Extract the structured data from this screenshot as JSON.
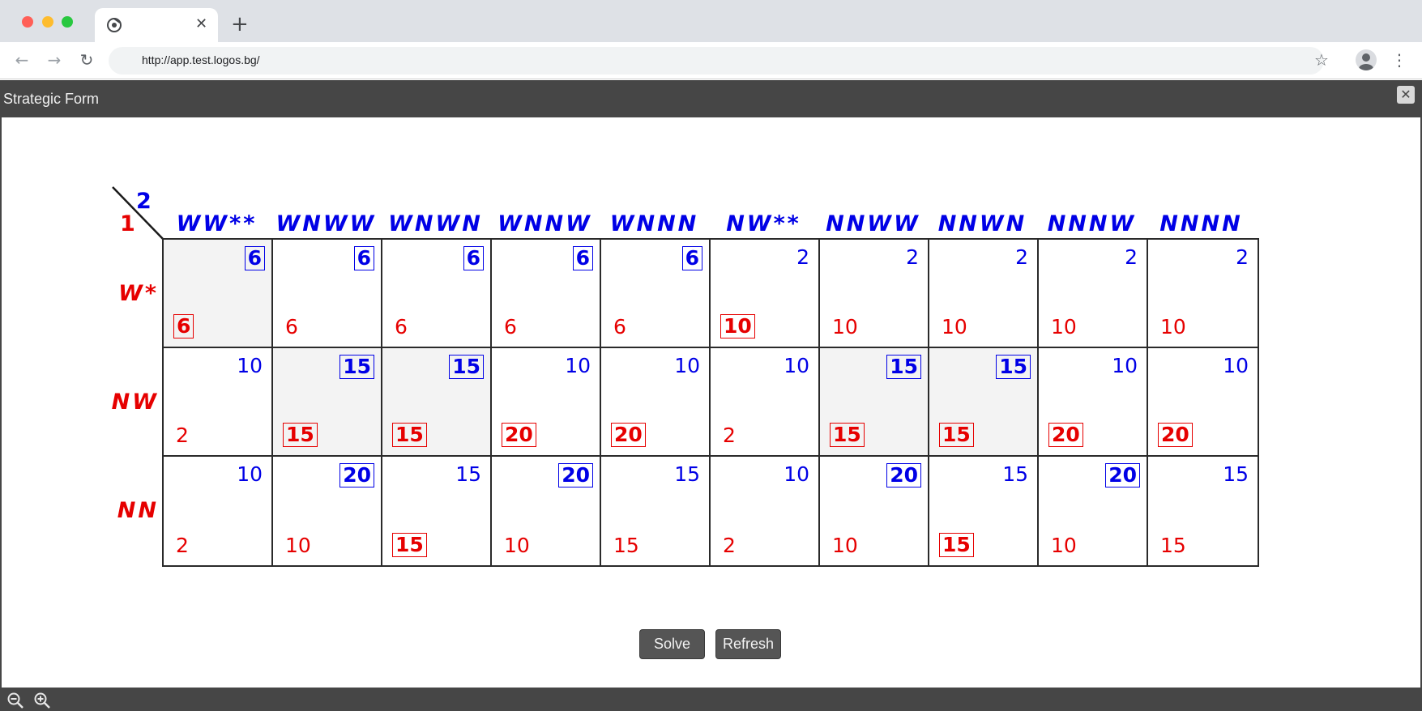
{
  "browser": {
    "url": "http://app.test.logos.bg/",
    "tab_title": ""
  },
  "dialog": {
    "title": "Strategic Form",
    "close_glyph": "✕"
  },
  "matrix": {
    "player1_label": "1",
    "player2_label": "2",
    "col_headers": [
      "WW**",
      "WNWW",
      "WNWN",
      "WNNW",
      "WNNN",
      "NW**",
      "NNWW",
      "NNWN",
      "NNNW",
      "NNNN"
    ],
    "row_headers": [
      "W*",
      "NW",
      "NN"
    ],
    "rows": [
      [
        {
          "p1": "6",
          "p1_best": true,
          "p2": "6",
          "p2_best": true,
          "highlight": true
        },
        {
          "p1": "6",
          "p1_best": false,
          "p2": "6",
          "p2_best": true,
          "highlight": false
        },
        {
          "p1": "6",
          "p1_best": false,
          "p2": "6",
          "p2_best": true,
          "highlight": false
        },
        {
          "p1": "6",
          "p1_best": false,
          "p2": "6",
          "p2_best": true,
          "highlight": false
        },
        {
          "p1": "6",
          "p1_best": false,
          "p2": "6",
          "p2_best": true,
          "highlight": false
        },
        {
          "p1": "10",
          "p1_best": true,
          "p2": "2",
          "p2_best": false,
          "highlight": false
        },
        {
          "p1": "10",
          "p1_best": false,
          "p2": "2",
          "p2_best": false,
          "highlight": false
        },
        {
          "p1": "10",
          "p1_best": false,
          "p2": "2",
          "p2_best": false,
          "highlight": false
        },
        {
          "p1": "10",
          "p1_best": false,
          "p2": "2",
          "p2_best": false,
          "highlight": false
        },
        {
          "p1": "10",
          "p1_best": false,
          "p2": "2",
          "p2_best": false,
          "highlight": false
        }
      ],
      [
        {
          "p1": "2",
          "p1_best": false,
          "p2": "10",
          "p2_best": false,
          "highlight": false
        },
        {
          "p1": "15",
          "p1_best": true,
          "p2": "15",
          "p2_best": true,
          "highlight": true
        },
        {
          "p1": "15",
          "p1_best": true,
          "p2": "15",
          "p2_best": true,
          "highlight": true
        },
        {
          "p1": "20",
          "p1_best": true,
          "p2": "10",
          "p2_best": false,
          "highlight": false
        },
        {
          "p1": "20",
          "p1_best": true,
          "p2": "10",
          "p2_best": false,
          "highlight": false
        },
        {
          "p1": "2",
          "p1_best": false,
          "p2": "10",
          "p2_best": false,
          "highlight": false
        },
        {
          "p1": "15",
          "p1_best": true,
          "p2": "15",
          "p2_best": true,
          "highlight": true
        },
        {
          "p1": "15",
          "p1_best": true,
          "p2": "15",
          "p2_best": true,
          "highlight": true
        },
        {
          "p1": "20",
          "p1_best": true,
          "p2": "10",
          "p2_best": false,
          "highlight": false
        },
        {
          "p1": "20",
          "p1_best": true,
          "p2": "10",
          "p2_best": false,
          "highlight": false
        }
      ],
      [
        {
          "p1": "2",
          "p1_best": false,
          "p2": "10",
          "p2_best": false,
          "highlight": false
        },
        {
          "p1": "10",
          "p1_best": false,
          "p2": "20",
          "p2_best": true,
          "highlight": false
        },
        {
          "p1": "15",
          "p1_best": true,
          "p2": "15",
          "p2_best": false,
          "highlight": false
        },
        {
          "p1": "10",
          "p1_best": false,
          "p2": "20",
          "p2_best": true,
          "highlight": false
        },
        {
          "p1": "15",
          "p1_best": false,
          "p2": "15",
          "p2_best": false,
          "highlight": false
        },
        {
          "p1": "2",
          "p1_best": false,
          "p2": "10",
          "p2_best": false,
          "highlight": false
        },
        {
          "p1": "10",
          "p1_best": false,
          "p2": "20",
          "p2_best": true,
          "highlight": false
        },
        {
          "p1": "15",
          "p1_best": true,
          "p2": "15",
          "p2_best": false,
          "highlight": false
        },
        {
          "p1": "10",
          "p1_best": false,
          "p2": "20",
          "p2_best": true,
          "highlight": false
        },
        {
          "p1": "15",
          "p1_best": false,
          "p2": "15",
          "p2_best": false,
          "highlight": false
        }
      ]
    ]
  },
  "buttons": {
    "solve": "Solve",
    "refresh": "Refresh"
  },
  "colors": {
    "player1": "#e60000",
    "player2": "#0000e6",
    "chrome_dark": "#464646",
    "highlight_cell": "#f3f3f3"
  },
  "icons": {
    "tab_favicon": "chrome-icon",
    "bookmark": "star-icon",
    "zoom_out": "zoom-out-icon",
    "zoom_in": "zoom-in-icon"
  }
}
